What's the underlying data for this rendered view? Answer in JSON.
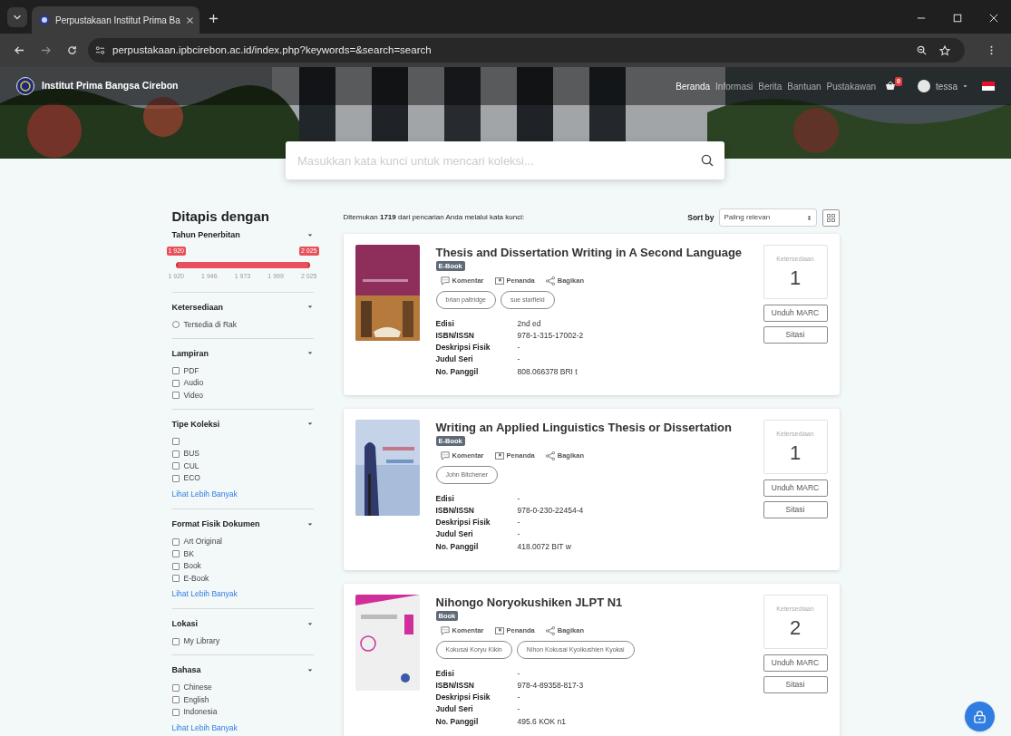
{
  "browser": {
    "tab_title": "Perpustakaan Institut Prima Ba",
    "url": "perpustakaan.ipbcirebon.ac.id/index.php?keywords=&search=search"
  },
  "header": {
    "site_name": "Institut Prima Bangsa Cirebon",
    "nav": [
      {
        "label": "Beranda",
        "selected": true
      },
      {
        "label": "Informasi",
        "selected": false
      },
      {
        "label": "Berita",
        "selected": false
      },
      {
        "label": "Bantuan",
        "selected": false
      },
      {
        "label": "Pustakawan",
        "selected": false
      }
    ],
    "cart_count": "0",
    "user": "tessa"
  },
  "search": {
    "placeholder": "Masukkan kata kunci untuk mencari koleksi..."
  },
  "filters": {
    "title": "Ditapis dengan",
    "sections": [
      {
        "kind": "range",
        "title": "Tahun Penerbitan",
        "min_label": "1 920",
        "max_label": "2 025",
        "level": 1,
        "ticks": [
          "1 920",
          "1 946",
          "1 973",
          "1 999",
          "2 025"
        ]
      },
      {
        "kind": "options",
        "title": "Ketersediaan",
        "options": [
          {
            "kind": "radio",
            "label": "Tersedia di Rak",
            "checked": false
          }
        ]
      },
      {
        "kind": "options",
        "title": "Lampiran",
        "options": [
          {
            "kind": "checkbox",
            "label": "PDF",
            "checked": false
          },
          {
            "kind": "checkbox",
            "label": "Audio",
            "checked": false
          },
          {
            "kind": "checkbox",
            "label": "Video",
            "checked": false
          }
        ]
      },
      {
        "kind": "options",
        "title": "Tipe Koleksi",
        "options": [
          {
            "kind": "checkbox",
            "checked": false
          },
          {
            "kind": "checkbox",
            "label": "BUS",
            "checked": false
          },
          {
            "kind": "checkbox",
            "label": "CUL",
            "checked": false
          },
          {
            "kind": "checkbox",
            "label": "ECO",
            "checked": false
          }
        ],
        "more_link": "Lihat Lebih Banyak"
      },
      {
        "kind": "options",
        "title": "Format Fisik Dokumen",
        "options": [
          {
            "kind": "checkbox",
            "label": "Art Original",
            "checked": false
          },
          {
            "kind": "checkbox",
            "label": "BK",
            "checked": false
          },
          {
            "kind": "checkbox",
            "label": "Book",
            "checked": false
          },
          {
            "kind": "checkbox",
            "label": "E-Book",
            "checked": false
          }
        ],
        "more_link": "Lihat Lebih Banyak"
      },
      {
        "kind": "options",
        "title": "Lokasi",
        "options": [
          {
            "kind": "checkbox",
            "label": "My Library",
            "checked": false
          }
        ]
      },
      {
        "kind": "options",
        "title": "Bahasa",
        "options": [
          {
            "kind": "checkbox",
            "label": "Chinese",
            "checked": false
          },
          {
            "kind": "checkbox",
            "label": "English",
            "checked": false
          },
          {
            "kind": "checkbox",
            "label": "Indonesia",
            "checked": false
          }
        ],
        "more_link": "Lihat Lebih Banyak"
      }
    ]
  },
  "results": {
    "summary": "Ditemukan **1719** dari pencarian Anda melalui kata kunci:",
    "sort_label": "Sort by",
    "sort_value": "Paling relevan",
    "items": [
      {
        "title": "Thesis and Dissertation Writing in A Second Language",
        "type": "E-Book",
        "actions": [
          "Komentar",
          "Penanda",
          "Bagikan"
        ],
        "authors": [
          "brian paltridge",
          "sue starfield"
        ],
        "fields": [
          {
            "label": "Edisi",
            "value": "2nd ed"
          },
          {
            "label": "ISBN/ISSN",
            "value": "978-1-315-17002-2"
          },
          {
            "label": "Deskripsi Fisik",
            "value": "-"
          },
          {
            "label": "Judul Seri",
            "value": "-"
          },
          {
            "label": "No. Panggil",
            "value": "808.066378 BRI t"
          }
        ],
        "availability_label": "Ketersediaan",
        "availability": "1",
        "buttons": [
          "Unduh MARC",
          "Sitasi"
        ]
      },
      {
        "title": "Writing an Applied Linguistics Thesis or Dissertation",
        "type": "E-Book",
        "actions": [
          "Komentar",
          "Penanda",
          "Bagikan"
        ],
        "authors": [
          "John Bitchener"
        ],
        "fields": [
          {
            "label": "Edisi",
            "value": "-"
          },
          {
            "label": "ISBN/ISSN",
            "value": "978-0-230-22454-4"
          },
          {
            "label": "Deskripsi Fisik",
            "value": "-"
          },
          {
            "label": "Judul Seri",
            "value": "-"
          },
          {
            "label": "No. Panggil",
            "value": "418.0072 BIT w"
          }
        ],
        "availability_label": "Ketersediaan",
        "availability": "1",
        "buttons": [
          "Unduh MARC",
          "Sitasi"
        ]
      },
      {
        "title": "Nihongo Noryokushiken JLPT N1",
        "type": "Book",
        "actions": [
          "Komentar",
          "Penanda",
          "Bagikan"
        ],
        "authors": [
          "Kokusai Koryu Kikin",
          "Nihon Kokusai Kyoikushien Kyokai"
        ],
        "fields": [
          {
            "label": "Edisi",
            "value": "-"
          },
          {
            "label": "ISBN/ISSN",
            "value": "978-4-89358-817-3"
          },
          {
            "label": "Deskripsi Fisik",
            "value": "-"
          },
          {
            "label": "Judul Seri",
            "value": "-"
          },
          {
            "label": "No. Panggil",
            "value": "495.6 KOK n1"
          }
        ],
        "availability_label": "Ketersediaan",
        "availability": "2",
        "buttons": [
          "Unduh MARC",
          "Sitasi"
        ]
      }
    ]
  }
}
